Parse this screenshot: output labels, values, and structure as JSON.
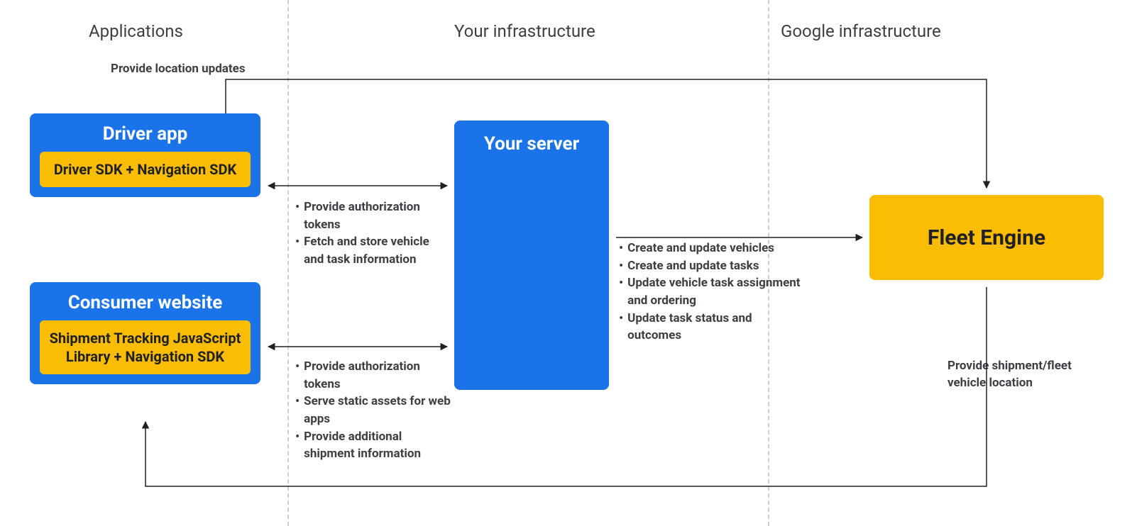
{
  "sections": {
    "applications": "Applications",
    "your_infra": "Your infrastructure",
    "google_infra": "Google infrastructure"
  },
  "driver_app": {
    "title": "Driver app",
    "chip": "Driver SDK + Navigation SDK"
  },
  "consumer": {
    "title": "Consumer website",
    "chip": "Shipment Tracking JavaScript Library  + Navigation SDK"
  },
  "server": {
    "title": "Your server"
  },
  "fleet": {
    "title": "Fleet Engine"
  },
  "labels": {
    "provide_location": "Provide location updates",
    "provide_shipment": "Provide shipment/fleet vehicle location"
  },
  "bullets_driver": [
    "Provide authorization tokens",
    "Fetch and store vehicle and task information"
  ],
  "bullets_consumer": [
    "Provide authorization tokens",
    "Serve static assets for web apps",
    "Provide additional shipment information"
  ],
  "bullets_server": [
    "Create and update vehicles",
    "Create and update tasks",
    "Update vehicle task assignment and ordering",
    "Update task status and outcomes"
  ]
}
